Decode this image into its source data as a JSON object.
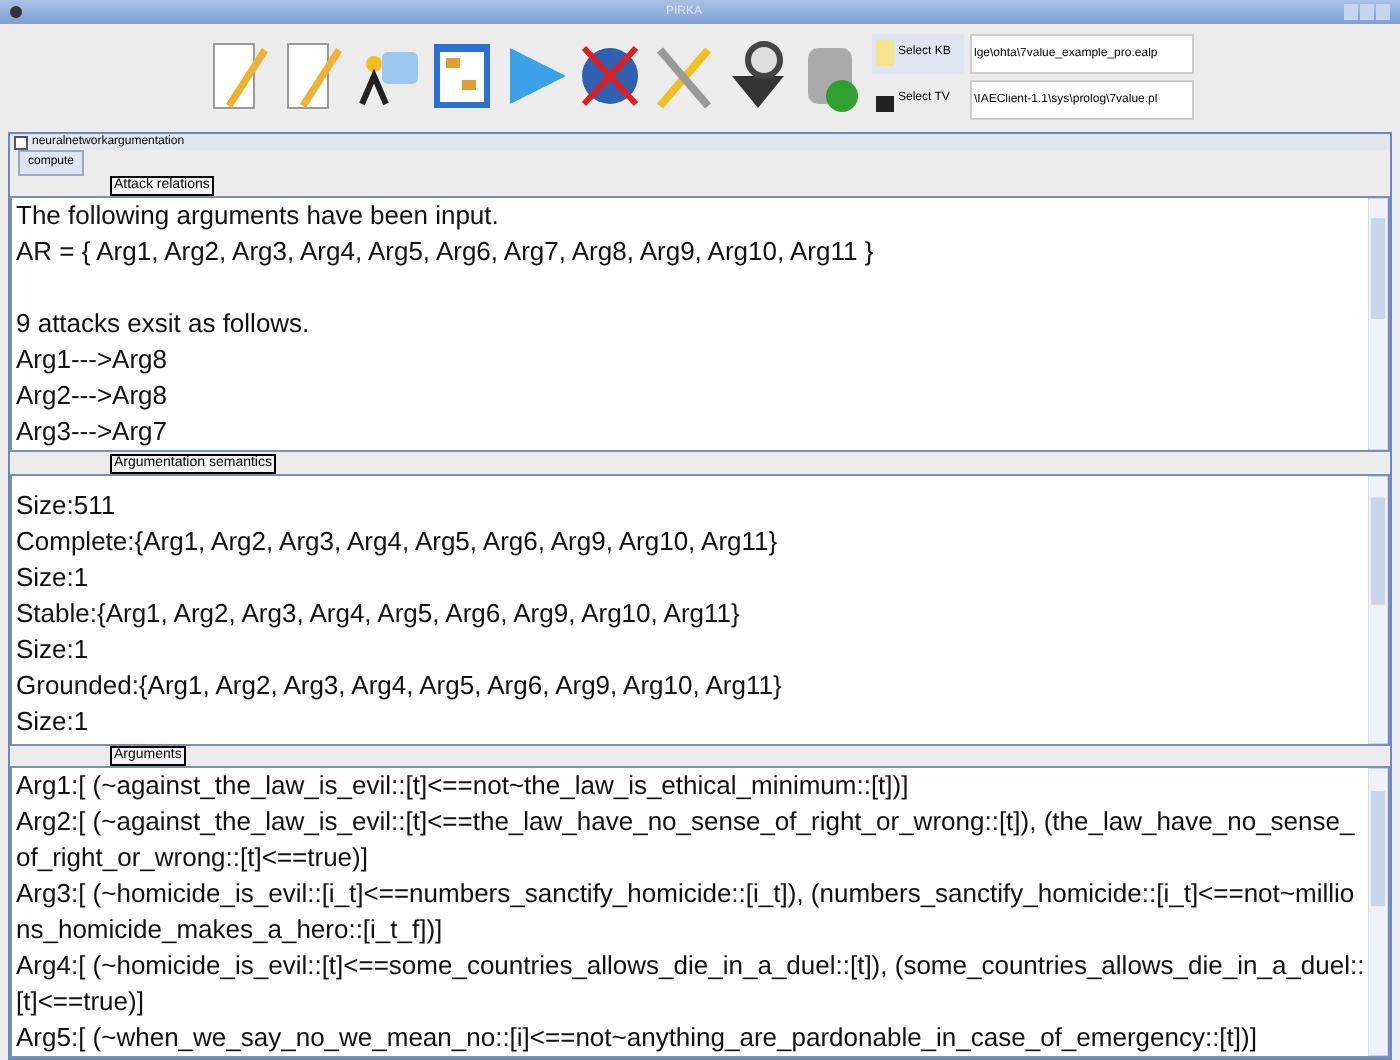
{
  "window": {
    "title": "PIRKA"
  },
  "toolbar": {
    "select_kb": {
      "label": "Select KB",
      "path": "lge\\ohta\\7value_example_pro.ealp"
    },
    "select_tv": {
      "label": "Select TV",
      "path": "\\IAEClient-1.1\\sys\\prolog\\7value.pl"
    }
  },
  "internal_frame": {
    "title": "neuralnetworkargumentation",
    "compute_button": "compute"
  },
  "panes": [
    {
      "label": "Attack relations",
      "paragraphs": [
        [
          "The following arguments have been input.",
          "AR = { Arg1, Arg2, Arg3, Arg4, Arg5, Arg6, Arg7, Arg8, Arg9, Arg10, Arg11 }"
        ],
        [
          "9 attacks exsit as follows.",
          "Arg1--->Arg8",
          "Arg2--->Arg8",
          "Arg3--->Arg7"
        ]
      ]
    },
    {
      "label": "Argumentation semantics",
      "paragraphs": [
        [
          "Size:511",
          "Complete:{Arg1, Arg2, Arg3, Arg4, Arg5, Arg6, Arg9, Arg10, Arg11}",
          "Size:1",
          "Stable:{Arg1, Arg2, Arg3, Arg4, Arg5, Arg6, Arg9, Arg10, Arg11}",
          "Size:1",
          "Grounded:{Arg1, Arg2, Arg3, Arg4, Arg5, Arg6, Arg9, Arg10, Arg11}",
          "Size:1"
        ]
      ]
    },
    {
      "label": "Arguments",
      "paragraphs": [
        [
          "Arg1:[ (~against_the_law_is_evil::[t]<==not~the_law_is_ethical_minimum::[t])]",
          "Arg2:[ (~against_the_law_is_evil::[t]<==the_law_have_no_sense_of_right_or_wrong::[t]), (the_law_have_no_sense_of_right_or_wrong::[t]<==true)]",
          "Arg3:[ (~homicide_is_evil::[i_t]<==numbers_sanctify_homicide::[i_t]), (numbers_sanctify_homicide::[i_t]<==not~millions_homicide_makes_a_hero::[i_t_f])]",
          "Arg4:[ (~homicide_is_evil::[t]<==some_countries_allows_die_in_a_duel::[t]), (some_countries_allows_die_in_a_duel::[t]<==true)]",
          "Arg5:[ (~when_we_say_no_we_mean_no::[i]<==not~anything_are_pardonable_in_case_of_emergency::[t])]"
        ]
      ]
    }
  ]
}
